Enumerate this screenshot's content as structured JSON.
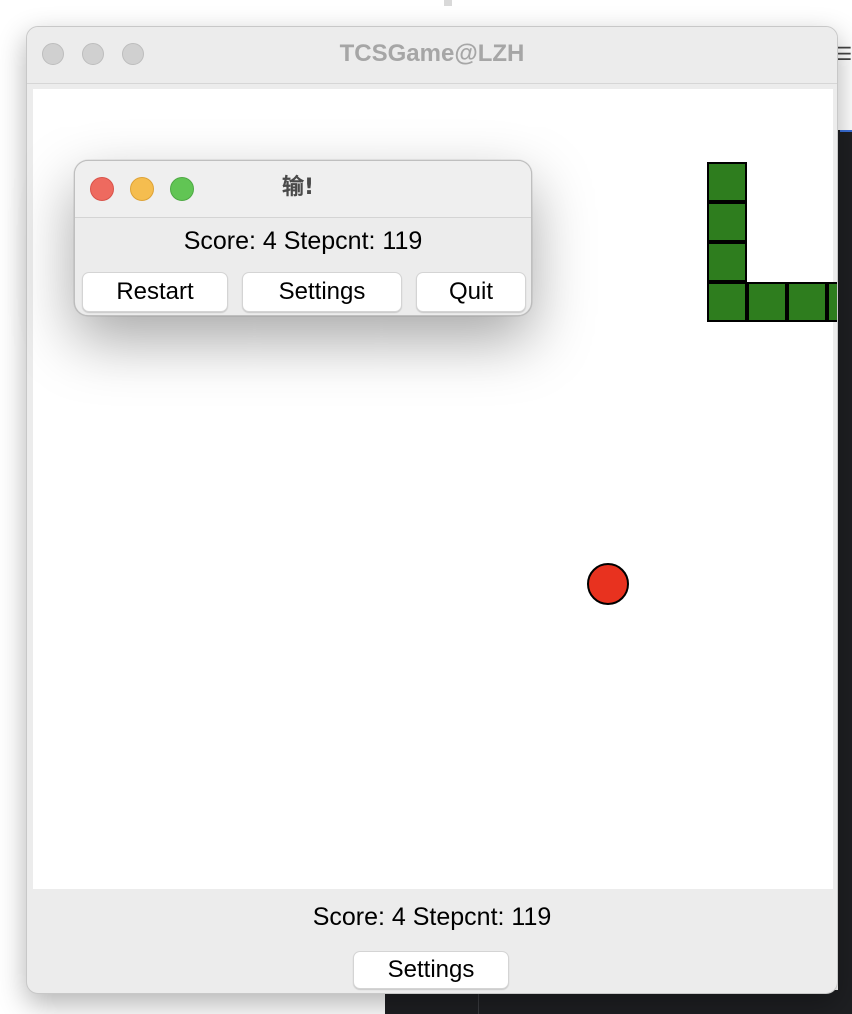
{
  "main_window": {
    "title": "TCSGame@LZH",
    "score_text": "Score: 4  Stepcnt: 119",
    "settings_label": "Settings"
  },
  "game": {
    "snake_color": "#2e7d1e",
    "food_color": "#e8321f",
    "grid_size": 20,
    "snake_cells": [
      [
        16,
        2
      ],
      [
        16,
        3
      ],
      [
        16,
        4
      ],
      [
        16,
        5
      ],
      [
        17,
        5
      ],
      [
        18,
        5
      ],
      [
        19,
        5
      ]
    ],
    "food_cell": [
      14,
      12
    ]
  },
  "dialog": {
    "title": "输!",
    "score_text": "Score: 4  Stepcnt: 119",
    "buttons": {
      "restart": "Restart",
      "settings": "Settings",
      "quit": "Quit"
    },
    "traffic_colors": {
      "close": "#ee6a5f",
      "minimize": "#f5bd4f",
      "maximize": "#61c554"
    }
  }
}
